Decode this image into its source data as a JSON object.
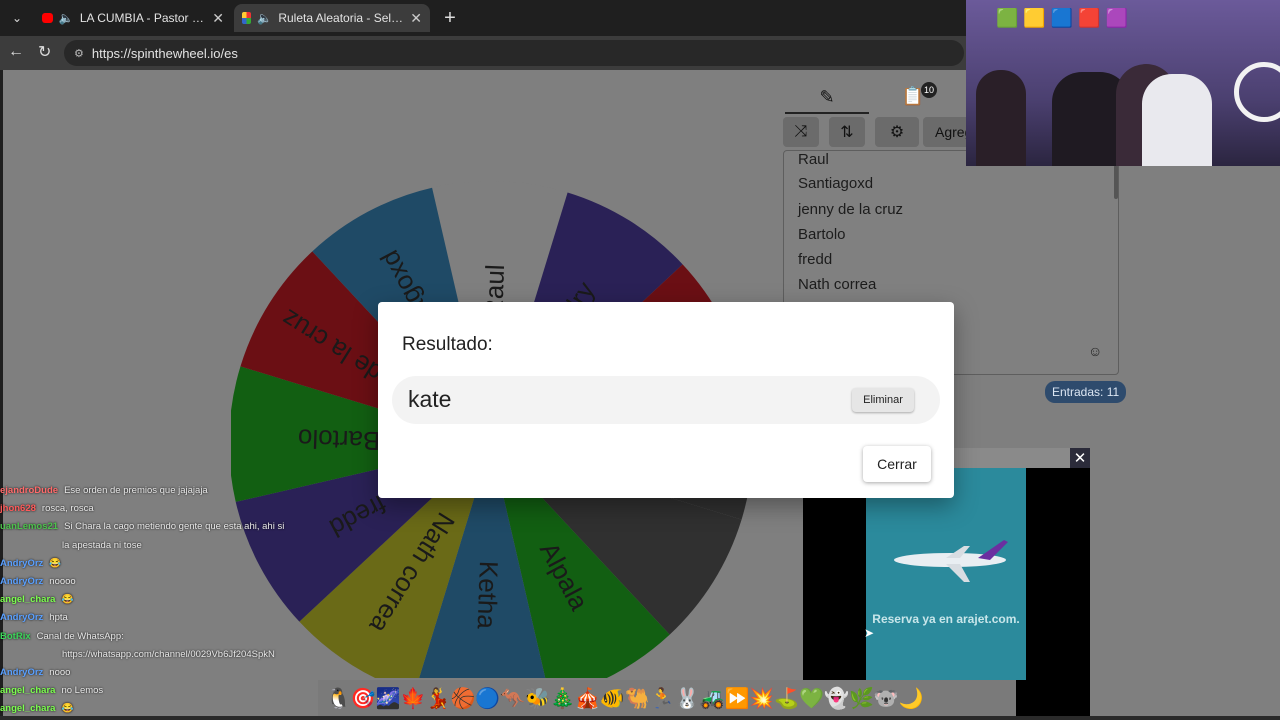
{
  "browser": {
    "tabs": [
      {
        "title": "LA CUMBIA - Pastor López (Vi",
        "icon": "youtube-icon",
        "active": false
      },
      {
        "title": "Ruleta Aleatoria - Selector Per",
        "icon": "spinthewheel-favicon",
        "active": true
      }
    ],
    "new_tab_label": "+",
    "url": "https://spinthewheel.io/es"
  },
  "toolbar": {
    "list_badge": "10",
    "add_label": "Agreg"
  },
  "names_list": [
    "Raul",
    "Santiagoxd",
    "jenny de la cruz",
    "Bartolo",
    "fredd",
    "Nath correa"
  ],
  "entries_count": "Entradas: 11",
  "wheel": {
    "segments": [
      {
        "label": "Raul",
        "color": "#7f7f7f"
      },
      {
        "label": "Andry",
        "color": "#2a2156"
      },
      {
        "label": "",
        "color": "#6b0f14"
      },
      {
        "label": "",
        "color": "#303030"
      },
      {
        "label": "",
        "color": "#303030"
      },
      {
        "label": "Alpala",
        "color": "#125f12"
      },
      {
        "label": "Ketha",
        "color": "#1f4a66"
      },
      {
        "label": "Nath correa",
        "color": "#6a6a17"
      },
      {
        "label": "fredd",
        "color": "#2a2156"
      },
      {
        "label": "Bartolo",
        "color": "#125f12"
      },
      {
        "label": "jenny de la cruz",
        "color": "#6b0f14"
      },
      {
        "label": "Santiagoxd",
        "color": "#1f4a66"
      }
    ],
    "label_color": "#1a1a1a"
  },
  "modal": {
    "title": "Resultado:",
    "result": "kate",
    "remove_label": "Eliminar",
    "close_label": "Cerrar"
  },
  "ad": {
    "text": "Reserva ya en arajet.com.",
    "brand": "arajet"
  },
  "chat": [
    {
      "user": "ejandroDude",
      "user_color": "#ff6b6b",
      "text": "Ese orden de premios que jajajaja"
    },
    {
      "user": "jhon628",
      "user_color": "#ff5a5a",
      "text": "rosca, rosca"
    },
    {
      "user": "uanLemos21",
      "user_color": "#4cc24c",
      "text": "Si Chara la cago metiendo gente que esta ahi, ahi si"
    },
    {
      "user": "",
      "user_color": "#ffffff",
      "text": "la apestada ni tose"
    },
    {
      "user": "AndryOrz",
      "user_color": "#5aa0ff",
      "text": "😂"
    },
    {
      "user": "AndryOrz",
      "user_color": "#5aa0ff",
      "text": "noooo"
    },
    {
      "user": "angel_chara",
      "user_color": "#7cff4f",
      "text": "😂"
    },
    {
      "user": "AndryOrz",
      "user_color": "#5aa0ff",
      "text": "hpta"
    },
    {
      "user": "BotRix",
      "user_color": "#3cd65a",
      "text": "Canal de WhatsApp:"
    },
    {
      "user": "",
      "user_color": "#ffffff",
      "text": "https://whatsapp.com/channel/0029Vb6Jf204SpkN"
    },
    {
      "user": "AndryOrz",
      "user_color": "#5aa0ff",
      "text": "nooo"
    },
    {
      "user": "angel_chara",
      "user_color": "#7cff4f",
      "text": "no Lemos"
    },
    {
      "user": "angel_chara",
      "user_color": "#7cff4f",
      "text": "😂"
    }
  ],
  "emoji_bar": "🐧🎯🌌🍁💃🏀🔵🦘🐝🎄🎪🐠🐫🏃🐰🚜⏩💥⛳💚👻🌿🐨🌙"
}
